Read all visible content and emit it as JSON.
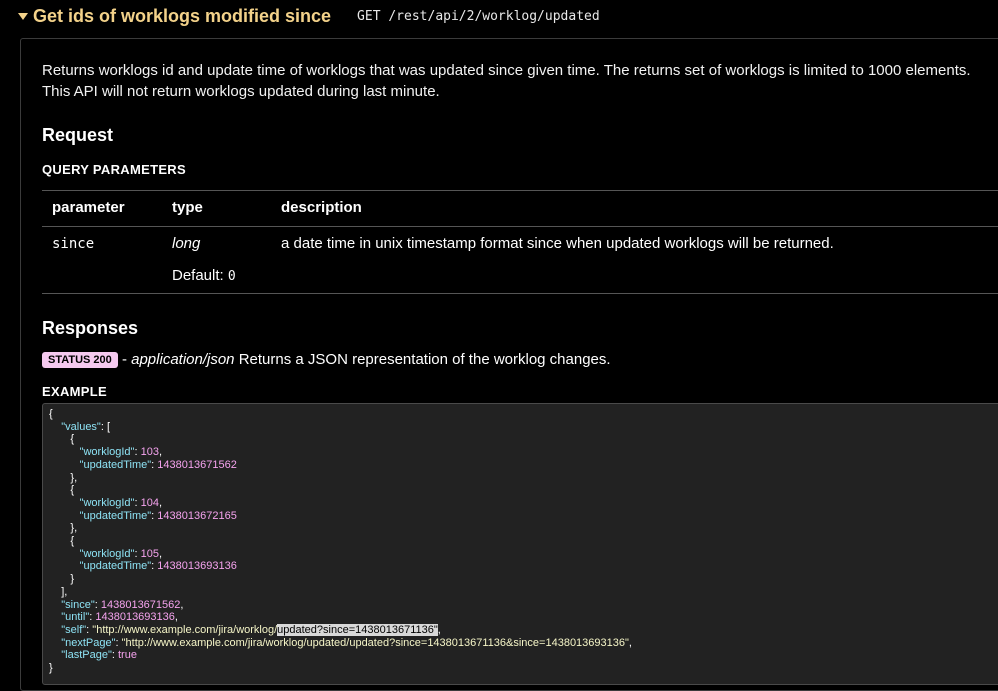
{
  "header": {
    "title": "Get ids of worklogs modified since",
    "method_path": "GET /rest/api/2/worklog/updated"
  },
  "description": "Returns worklogs id and update time of worklogs that was updated since given time. The returns set of worklogs is limited to 1000 elements. This API will not return worklogs updated during last minute.",
  "request": {
    "heading": "Request",
    "query_heading": "QUERY PARAMETERS",
    "columns": [
      "parameter",
      "type",
      "description"
    ],
    "rows": [
      {
        "name": "since",
        "type": "long",
        "default_label": "Default: ",
        "default_value": "0",
        "description": "a date time in unix timestamp format since when updated worklogs will be returned."
      }
    ]
  },
  "responses": {
    "heading": "Responses",
    "status_badge": "STATUS 200",
    "dash": " - ",
    "content_type": "application/json",
    "status_text": " Returns a JSON representation of the worklog changes.",
    "example_heading": "EXAMPLE"
  },
  "example": {
    "open_brace": "{",
    "values_key": "\"values\"",
    "items": [
      {
        "worklogId": "103",
        "updatedTime": "1438013671562"
      },
      {
        "worklogId": "104",
        "updatedTime": "1438013672165"
      },
      {
        "worklogId": "105",
        "updatedTime": "1438013693136"
      }
    ],
    "since": "1438013671562",
    "until": "1438013693136",
    "self_prefix": "\"http://www.example.com/jira/worklog/",
    "self_highlight": "updated?since=1438013671136\"",
    "next_page": "\"http://www.example.com/jira/worklog/updated/updated?since=1438013671136&since=1438013693136\"",
    "last_page": "true"
  },
  "colors": {
    "title": "#f3d28a",
    "badge": "#f5c9ef",
    "key": "#8ee3f5",
    "number": "#f5a3ee"
  }
}
